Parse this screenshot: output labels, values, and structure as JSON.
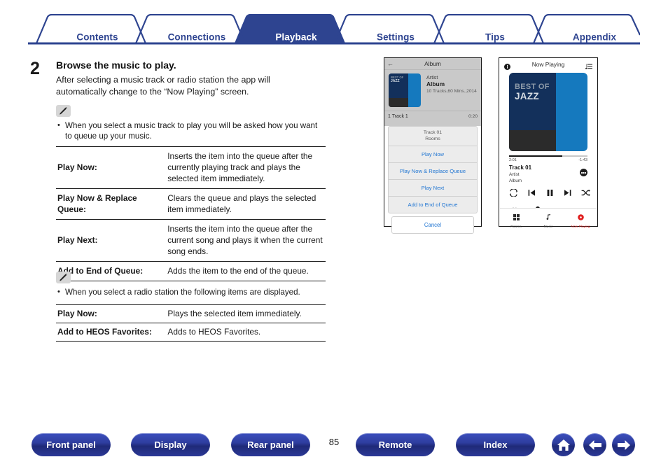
{
  "colors": {
    "brand_blue": "#2e4490",
    "tab_active_bg": "#2e4490",
    "link_blue": "#2176d2",
    "accent_red": "#e02020"
  },
  "tabs": [
    {
      "label": "Contents",
      "active": false
    },
    {
      "label": "Connections",
      "active": false
    },
    {
      "label": "Playback",
      "active": true
    },
    {
      "label": "Settings",
      "active": false
    },
    {
      "label": "Tips",
      "active": false
    },
    {
      "label": "Appendix",
      "active": false
    }
  ],
  "step": {
    "number": "2",
    "title": "Browse the music to play.",
    "body": "After selecting a music track or radio station the app will automatically change to the “Now Playing” screen."
  },
  "note1": {
    "icon": "pencil-icon",
    "text": "When you select a music track to play you will be asked how you want to queue up your music."
  },
  "table1": {
    "rows": [
      {
        "key": "Play Now:",
        "value": "Inserts the item into the queue after the currently playing track and plays the selected item immediately."
      },
      {
        "key": "Play Now & Replace Queue:",
        "value": "Clears the queue and plays the selected item immediately."
      },
      {
        "key": "Play Next:",
        "value": "Inserts the item into the queue after the current song and plays it when the current song ends."
      },
      {
        "key": "Add to End of Queue:",
        "value": "Adds the item to the end of the queue."
      }
    ]
  },
  "note2": {
    "icon": "pencil-icon",
    "text": "When you select a radio station the following items are displayed."
  },
  "table2": {
    "rows": [
      {
        "key": "Play Now:",
        "value": "Plays the selected item immediately."
      },
      {
        "key": "Add to HEOS Favorites:",
        "value": "Adds to HEOS Favorites."
      }
    ]
  },
  "phone_album": {
    "back_icon": "back-arrow-icon",
    "title": "Album",
    "art_line1": "BEST OF",
    "art_line2": "JAZZ",
    "artist": "Artist",
    "album": "Album",
    "info": "10 Tracks,60 Mins.,2014",
    "track_row": {
      "name": "1 Track 1",
      "time": "0:20"
    },
    "sheet": {
      "header_line1": "Track 01",
      "header_line2": "Rooms",
      "items": [
        "Play Now",
        "Play Now & Replace Queue",
        "Play Next",
        "Add to End of Queue"
      ],
      "cancel": "Cancel"
    }
  },
  "phone_nowplaying": {
    "info_icon": "info-icon",
    "title": "Now Playing",
    "queue_icon": "queue-list-icon",
    "art_line1": "BEST OF",
    "art_line2": "JAZZ",
    "elapsed": "2:01",
    "remaining": "-1:43",
    "track": "Track 01",
    "artist": "Artist",
    "album": "Album",
    "more_icon": "more-options-icon",
    "controls": [
      "repeat-icon",
      "previous-icon",
      "pause-icon",
      "next-icon",
      "shuffle-icon"
    ],
    "volume_icon": "volume-icon",
    "tabs": [
      {
        "label": "Rooms",
        "icon": "rooms-grid-icon",
        "active": false
      },
      {
        "label": "Music",
        "icon": "music-note-icon",
        "active": false
      },
      {
        "label": "Now Playing",
        "icon": "now-playing-icon",
        "active": true
      }
    ]
  },
  "footer": {
    "buttons": [
      "Front panel",
      "Display",
      "Rear panel",
      "Remote",
      "Index"
    ],
    "page_number": "85",
    "nav_icons": [
      "home-icon",
      "back-arrow-icon",
      "forward-arrow-icon"
    ]
  }
}
